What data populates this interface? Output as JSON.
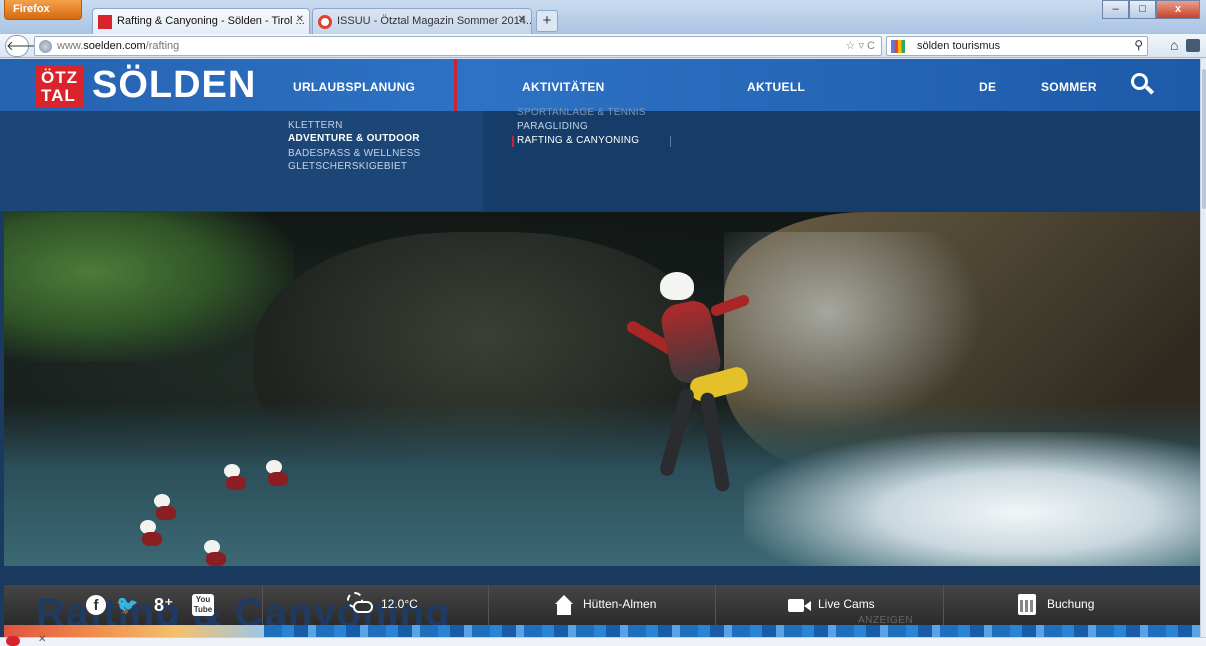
{
  "browser": {
    "menu_button": "Firefox",
    "tabs": [
      {
        "label": "Rafting & Canyoning - Sölden - Tirol ...",
        "active": true,
        "favicon": "oetztal-favicon"
      },
      {
        "label": "ISSUU - Ötztal Magazin Sommer 2014...",
        "active": false,
        "favicon": "issuu-favicon"
      }
    ],
    "new_tab": "+",
    "url_prefix": "www.",
    "url_domain": "soelden.com",
    "url_path": "/rafting",
    "search_value": "sölden tourismus",
    "window_controls": {
      "minimize": "–",
      "maximize": "□",
      "close": "x"
    }
  },
  "site": {
    "logo_badge_line1": "ÖTZ",
    "logo_badge_line2": "TAL",
    "logo_text": "SÖLDEN",
    "nav": {
      "planning": "URLAUBSPLANUNG",
      "activities": "AKTIVITÄTEN",
      "news": "AKTUELL",
      "language": "DE",
      "season": "SOMMER"
    },
    "dropdown_left": [
      {
        "label": "KLETTERN",
        "state": "normal"
      },
      {
        "label": "ADVENTURE & OUTDOOR",
        "state": "active"
      },
      {
        "label": "BADESPASS & WELLNESS",
        "state": "normal"
      },
      {
        "label": "GLETSCHERSKIGEBIET",
        "state": "normal"
      }
    ],
    "dropdown_right": [
      {
        "label": "SPORTANLAGE & TENNIS",
        "state": "faded"
      },
      {
        "label": "PARAGLIDING",
        "state": "normal"
      },
      {
        "label": "RAFTING & CANYONING",
        "state": "active"
      }
    ],
    "info_bar": {
      "temperature": "12.0°C",
      "huts": "Hütten-Almen",
      "cams": "Live Cams",
      "booking": "Buchung",
      "ads": "ANZEIGEN",
      "social": {
        "twitter": "🐦",
        "gplus": "8⁺",
        "facebook": "f",
        "youtube_line1": "You",
        "youtube_line2": "Tube"
      }
    },
    "ghost_title": "Rafting & Canyoning"
  },
  "colors": {
    "header_blue": "#2563b0",
    "brand_red": "#d9232d",
    "dropdown_bg": "#163d6a"
  }
}
